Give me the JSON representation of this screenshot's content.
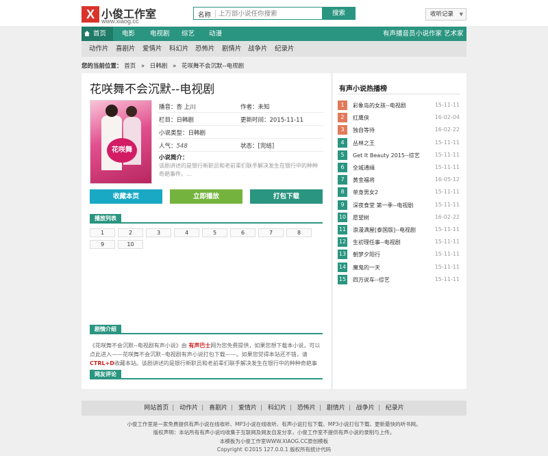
{
  "header": {
    "logo_mark": "X",
    "logo_name": "小俊工作室",
    "logo_url": "www.xiaog.cc",
    "search_type": "名称",
    "search_placeholder": "上万部小说任你搜索",
    "search_button": "搜索",
    "history_label": "收听记录"
  },
  "nav": {
    "items": [
      "首页",
      "电影",
      "电视剧",
      "综艺",
      "动漫"
    ],
    "right_links": [
      "有声播音员",
      "小说作家",
      "艺术家"
    ]
  },
  "subnav": [
    "动作片",
    "喜剧片",
    "爱情片",
    "科幻片",
    "恐怖片",
    "剧情片",
    "战争片",
    "纪录片"
  ],
  "breadcrumb": {
    "label": "您的当前位置：",
    "items": [
      "首页",
      "日韩剧",
      "花咲舞不会沉默--电视剧"
    ],
    "sep": "»"
  },
  "detail": {
    "title": "花咲舞不会沉默--电视剧",
    "cover_text": "花咲舞",
    "rows": [
      [
        "播音：杏 上川",
        "作者：未知"
      ],
      [
        "栏目：日韩剧",
        "更新时间：2015-11-11"
      ],
      [
        "小说类型：日韩剧",
        ""
      ],
      [
        "人气：",
        "状态：[完结]"
      ]
    ],
    "popularity": "548",
    "intro_heading": "小说简介：",
    "intro_text": "该剧讲述的是银行新职员和老前辈们联手解决发生在银行中的种种奇葩事件。..."
  },
  "buttons": {
    "collect": "收藏本页",
    "play": "立即播放",
    "download": "打包下载"
  },
  "episodes": {
    "heading": "播放列表",
    "list": [
      "1",
      "2",
      "3",
      "4",
      "5",
      "6",
      "7",
      "8",
      "9",
      "10"
    ]
  },
  "story": {
    "heading": "剧情介绍",
    "part1": "《花咲舞不会沉默--电视剧有声小说》由",
    "site": "有声巴士",
    "part2": "网为您免费提供，如果您想下载本小说，可以点此进入——",
    "part3": "花咲舞不会沉默--电视剧有声小说打包下载——",
    "part4": "。如果您觉得本站还不错，请",
    "ctrl": "CTRL+D",
    "part5": "收藏本站。该剧讲述的是银行新职员和老前辈们联手解决发生在银行中的种种奇葩事件。"
  },
  "comments": {
    "heading": "网友评论"
  },
  "sidebar": {
    "heading": "有声小说热播榜",
    "items": [
      {
        "n": "1",
        "title": "彩象岛的女孩--电视剧",
        "date": "15-11-11"
      },
      {
        "n": "2",
        "title": "红鹰侠",
        "date": "16-02-04"
      },
      {
        "n": "3",
        "title": "独自等待",
        "date": "16-02-22"
      },
      {
        "n": "4",
        "title": "丛林之王",
        "date": "15-11-11"
      },
      {
        "n": "5",
        "title": "Get It Beauty 2015--综艺",
        "date": "15-11-11"
      },
      {
        "n": "6",
        "title": "全城通缉",
        "date": "15-11-11"
      },
      {
        "n": "7",
        "title": "黄金福将",
        "date": "16-05-12"
      },
      {
        "n": "8",
        "title": "单身男女2",
        "date": "15-11-11"
      },
      {
        "n": "9",
        "title": "深夜食堂 第一季--电视剧",
        "date": "15-11-11"
      },
      {
        "n": "10",
        "title": "愿望树",
        "date": "16-02-22"
      },
      {
        "n": "11",
        "title": "浪漫满屋[泰国版]--电视剧",
        "date": "15-11-11"
      },
      {
        "n": "12",
        "title": "生初理任事--电视剧",
        "date": "15-11-11"
      },
      {
        "n": "13",
        "title": "朝梦夕阳行",
        "date": "15-11-11"
      },
      {
        "n": "14",
        "title": "魔鬼的一天",
        "date": "15-11-11"
      },
      {
        "n": "15",
        "title": "四万说车--综艺",
        "date": "15-11-11"
      }
    ]
  },
  "footer": {
    "links": [
      "网站首页",
      "动作片",
      "喜剧片",
      "爱情片",
      "科幻片",
      "恐怖片",
      "剧情片",
      "战争片",
      "纪录片"
    ],
    "line1": "小俊工作室是一家免费提供有声小说在线收听、MP3小说在线收听、有声小说打包下载、MP3小说打包下载、更新最快的听书网。",
    "line2": "版权声明：本站所有有声小说均收集于互联网及网友自发分享，小俊工作室不提供有声小说的录制与上传。",
    "line3": "本模板为小俊工作室WWW.XIAOG.CC原创模板",
    "line4": "Copyright ©2015 127.0.0.1 版权所有统计代码"
  },
  "colors": {
    "accent": "#2a9580",
    "collect_button": "#1aa9c4",
    "play_button": "#74b43e",
    "download_button": "#2a9580"
  }
}
